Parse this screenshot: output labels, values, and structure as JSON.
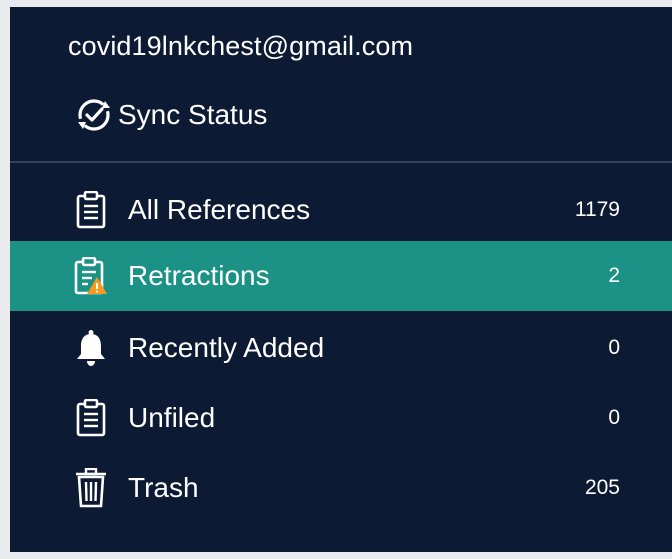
{
  "account": {
    "email": "covid19lnkchest@gmail.com"
  },
  "sync": {
    "label": "Sync Status",
    "icon": "sync-check-icon"
  },
  "nav": {
    "items": [
      {
        "label": "All References",
        "count": "1179",
        "icon": "clipboard-icon",
        "selected": false
      },
      {
        "label": "Retractions",
        "count": "2",
        "icon": "clipboard-warning-icon",
        "selected": true
      },
      {
        "label": "Recently Added",
        "count": "0",
        "icon": "bell-icon",
        "selected": false
      },
      {
        "label": "Unfiled",
        "count": "0",
        "icon": "clipboard-icon",
        "selected": false
      },
      {
        "label": "Trash",
        "count": "205",
        "icon": "trash-icon",
        "selected": false
      }
    ]
  },
  "colors": {
    "panel_background": "#0d1a33",
    "selected_background": "#1b9285",
    "warning": "#f59a23",
    "text": "#ffffff"
  }
}
